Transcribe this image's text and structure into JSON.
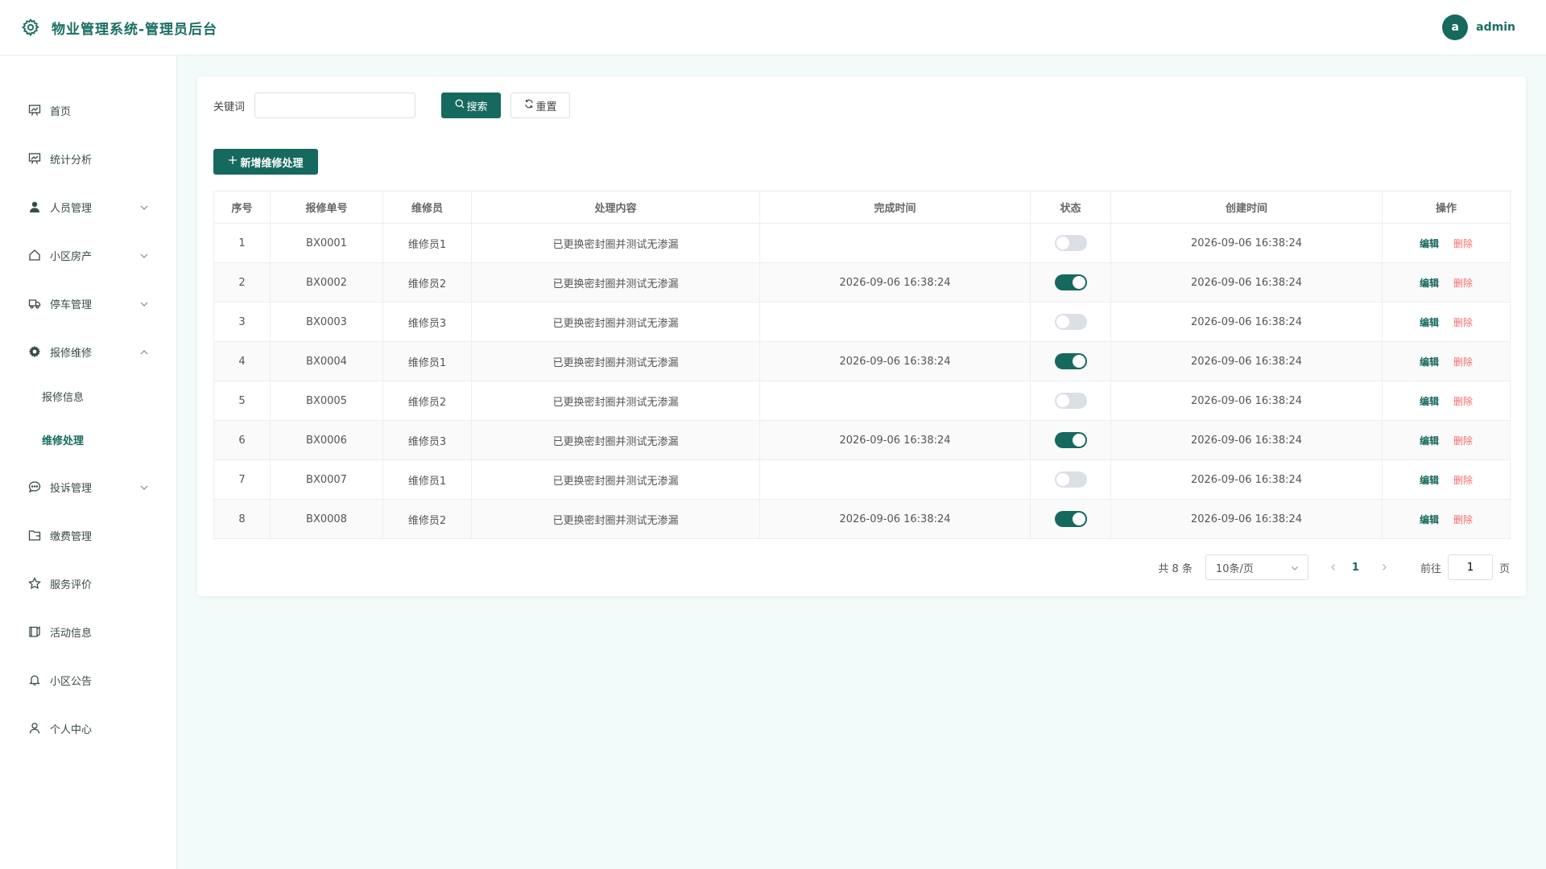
{
  "header": {
    "title": "物业管理系统-管理员后台",
    "avatar_letter": "a",
    "username": "admin"
  },
  "sidebar": {
    "items": [
      {
        "label": "首页",
        "icon": "chart-board-icon"
      },
      {
        "label": "统计分析",
        "icon": "chart-board-icon"
      },
      {
        "label": "人员管理",
        "icon": "user-icon"
      },
      {
        "label": "小区房产",
        "icon": "house-icon"
      },
      {
        "label": "停车管理",
        "icon": "truck-icon"
      },
      {
        "label": "报修维修",
        "icon": "gear-icon"
      },
      {
        "label": "投诉管理",
        "icon": "chat-icon"
      },
      {
        "label": "缴费管理",
        "icon": "wallet-icon"
      },
      {
        "label": "服务评价",
        "icon": "star-icon"
      },
      {
        "label": "活动信息",
        "icon": "notebook-icon"
      },
      {
        "label": "小区公告",
        "icon": "bell-icon"
      },
      {
        "label": "个人中心",
        "icon": "user-outline-icon"
      }
    ],
    "sub_items": [
      {
        "label": "报修信息"
      },
      {
        "label": "维修处理"
      }
    ]
  },
  "search": {
    "label": "关键词",
    "value": "",
    "placeholder": "",
    "search_btn": "搜索",
    "reset_btn": "重置"
  },
  "add_btn": "新增维修处理",
  "table": {
    "headers": [
      "序号",
      "报修单号",
      "维修员",
      "处理内容",
      "完成时间",
      "状态",
      "创建时间",
      "操作"
    ],
    "rows": [
      {
        "no": "1",
        "order": "BX0001",
        "worker": "维修员1",
        "content": "已更换密封圈并测试无渗漏",
        "finish": "",
        "status": false,
        "created": "2026-09-06 16:38:24"
      },
      {
        "no": "2",
        "order": "BX0002",
        "worker": "维修员2",
        "content": "已更换密封圈并测试无渗漏",
        "finish": "2026-09-06 16:38:24",
        "status": true,
        "created": "2026-09-06 16:38:24"
      },
      {
        "no": "3",
        "order": "BX0003",
        "worker": "维修员3",
        "content": "已更换密封圈并测试无渗漏",
        "finish": "",
        "status": false,
        "created": "2026-09-06 16:38:24"
      },
      {
        "no": "4",
        "order": "BX0004",
        "worker": "维修员1",
        "content": "已更换密封圈并测试无渗漏",
        "finish": "2026-09-06 16:38:24",
        "status": true,
        "created": "2026-09-06 16:38:24"
      },
      {
        "no": "5",
        "order": "BX0005",
        "worker": "维修员2",
        "content": "已更换密封圈并测试无渗漏",
        "finish": "",
        "status": false,
        "created": "2026-09-06 16:38:24"
      },
      {
        "no": "6",
        "order": "BX0006",
        "worker": "维修员3",
        "content": "已更换密封圈并测试无渗漏",
        "finish": "2026-09-06 16:38:24",
        "status": true,
        "created": "2026-09-06 16:38:24"
      },
      {
        "no": "7",
        "order": "BX0007",
        "worker": "维修员1",
        "content": "已更换密封圈并测试无渗漏",
        "finish": "",
        "status": false,
        "created": "2026-09-06 16:38:24"
      },
      {
        "no": "8",
        "order": "BX0008",
        "worker": "维修员2",
        "content": "已更换密封圈并测试无渗漏",
        "finish": "2026-09-06 16:38:24",
        "status": true,
        "created": "2026-09-06 16:38:24"
      }
    ],
    "edit_label": "编辑",
    "delete_label": "删除"
  },
  "pagination": {
    "total": "共 8 条",
    "page_size": "10条/页",
    "current": "1",
    "goto_label": "前往",
    "goto_value": "1",
    "page_suffix": "页"
  },
  "colors": {
    "primary": "#16695e",
    "danger": "#f56c6c",
    "background": "#f2fbf9"
  }
}
